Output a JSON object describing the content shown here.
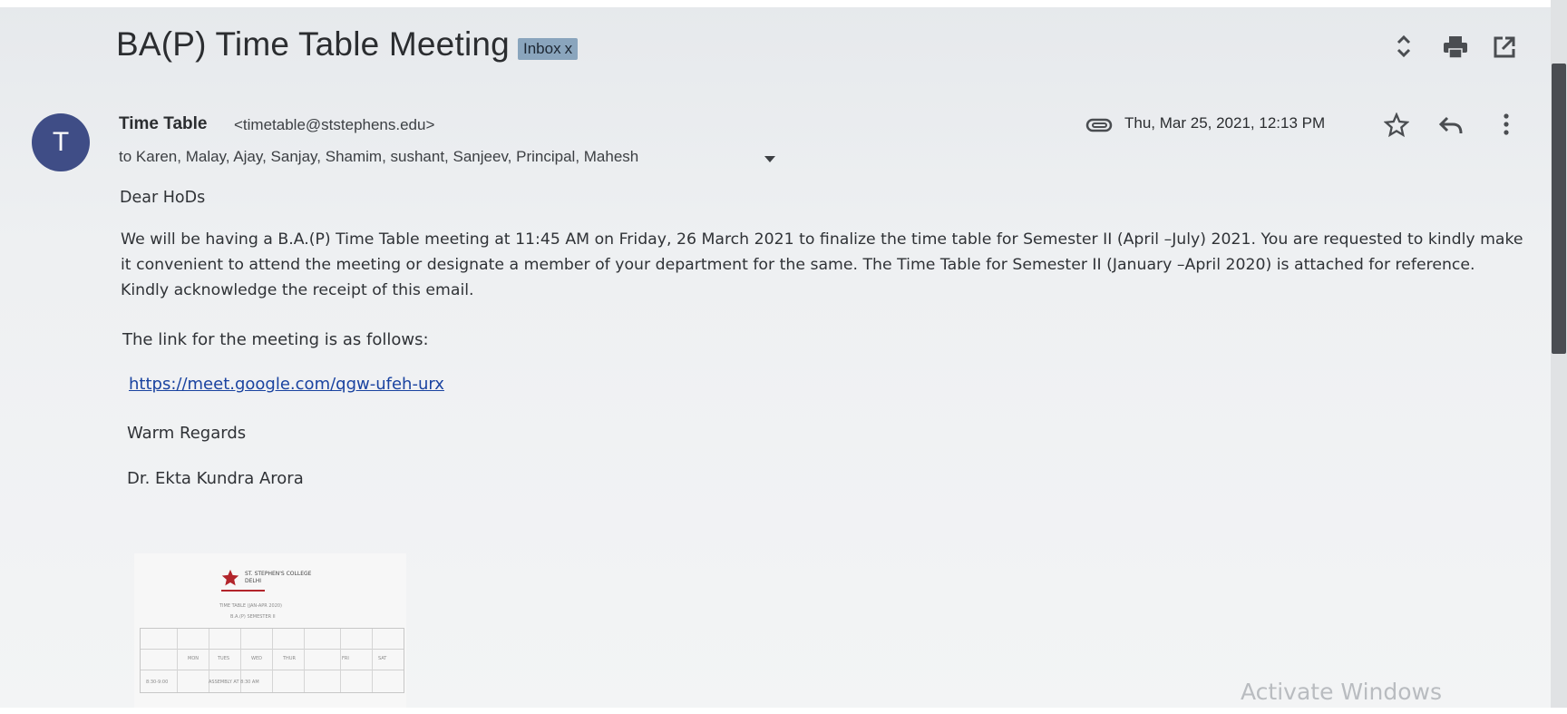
{
  "email": {
    "subject": "BA(P) Time Table Meeting",
    "label": "Inbox",
    "label_remove": "x",
    "sender": {
      "avatar_letter": "T",
      "name": "Time Table",
      "email": "<timetable@ststephens.edu>"
    },
    "recipients": "to Karen, Malay, Ajay, Sanjay, Shamim, sushant, Sanjeev, Principal, Mahesh",
    "date": "Thu, Mar 25, 2021, 12:13 PM",
    "body": {
      "greeting": "Dear HoDs",
      "paragraph": "We will be having a B.A.(P) Time Table meeting at 11:45 AM on Friday, 26 March 2021 to finalize the time table for Semester II (April –July) 2021. You are requested to kindly make it convenient to attend the meeting or designate a member of your department for the same. The Time Table for Semester II (January –April 2020) is attached for reference. Kindly acknowledge the receipt of this email.",
      "link_intro": "The link for the meeting is as follows:",
      "meet_link": "https://meet.google.com/qgw-ufeh-urx",
      "closing": "Warm Regards",
      "signature": "Dr. Ekta Kundra Arora"
    },
    "attachment": {
      "heading_line1": "ST. STEPHEN'S COLLEGE",
      "heading_line2": "DELHI",
      "title_line1": "TIME TABLE (JAN-APR 2020)",
      "title_line2": "B.A.(P) SEMESTER II",
      "days": [
        "MON",
        "TUES",
        "WED",
        "THUR",
        "FRI",
        "SAT"
      ],
      "row_label": "8:30-9:00",
      "row_text": "ASSEMBLY AT 8:30 AM"
    }
  },
  "watermark": "Activate Windows",
  "icons": {
    "expand": "unfold-icon",
    "print": "print-icon",
    "popout": "open-in-new-window-icon",
    "attachment": "paperclip-icon",
    "star": "star-icon",
    "reply": "reply-icon",
    "more": "more-vert-icon",
    "recipients_toggle": "caret-down-icon"
  },
  "colors": {
    "avatar": "#3f4d86",
    "label_chip": "#8aa5bd",
    "link": "#1a43a0"
  }
}
